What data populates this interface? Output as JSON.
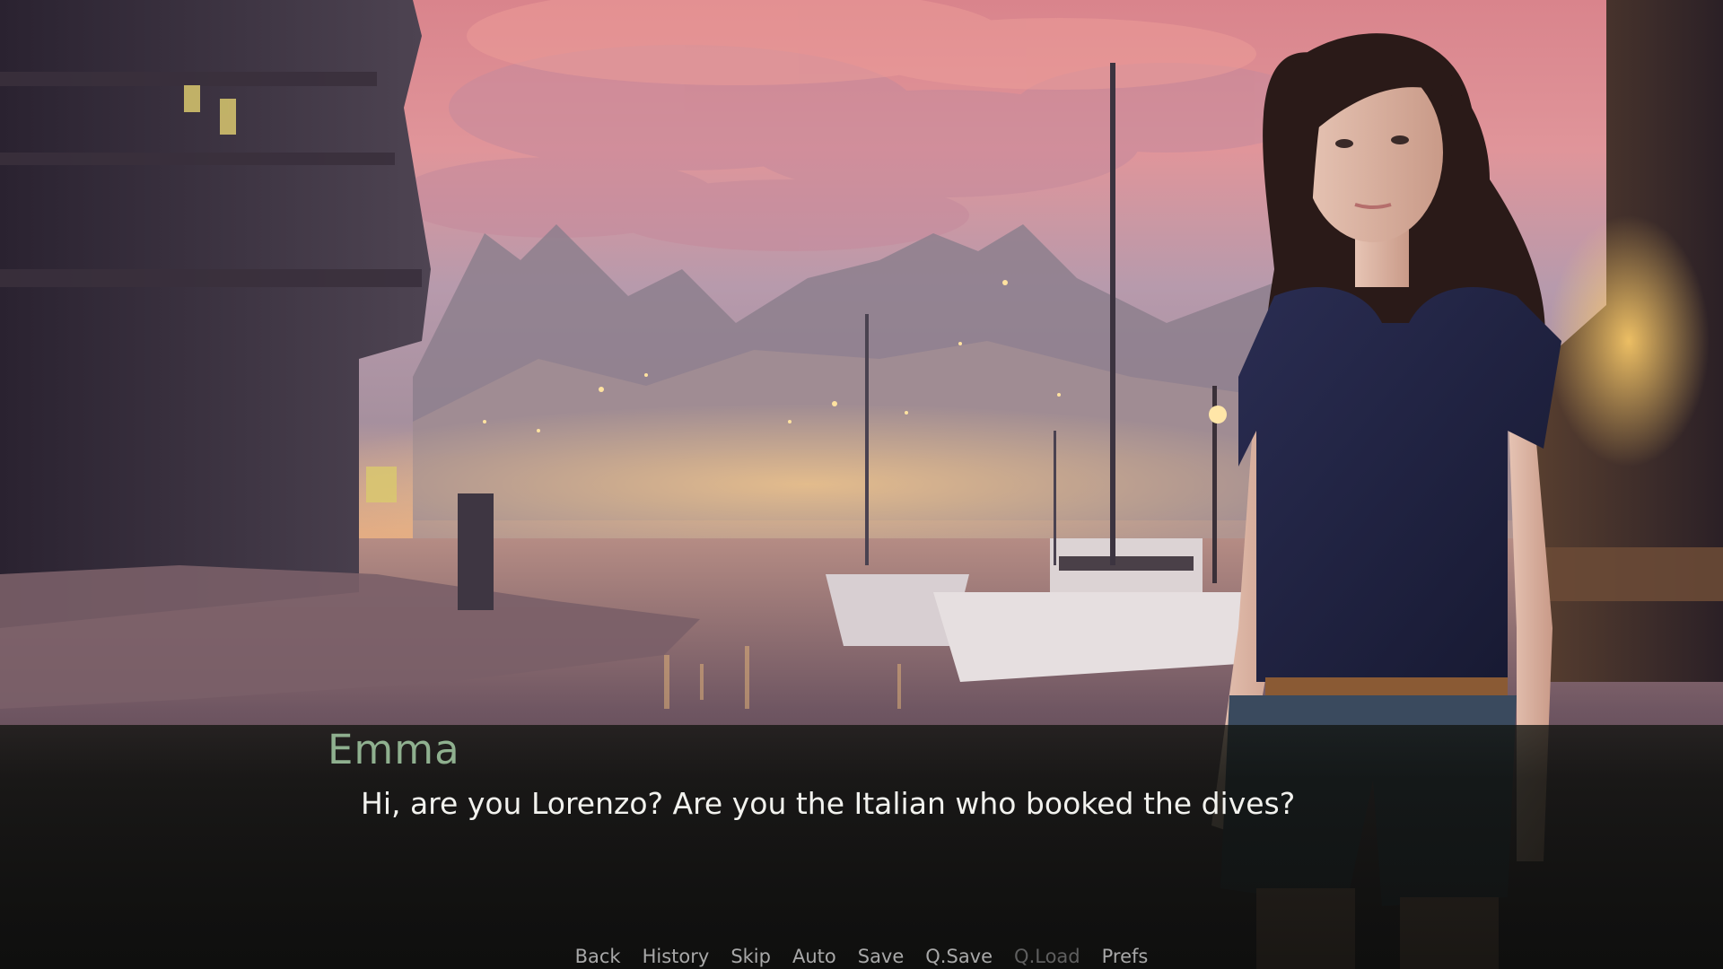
{
  "scene": {
    "background": "harbor-at-dusk",
    "character": "emma-sprite",
    "colors": {
      "sky_top": "#e38e92",
      "sky_mid": "#c49aa6",
      "haze": "#f2b277",
      "water": "#6b5560",
      "shirt": "#1d1f3a",
      "hair": "#2a1a18"
    }
  },
  "dialogue": {
    "speaker": "Emma",
    "speaker_color": "#8fb08f",
    "text": "Hi, are you Lorenzo? Are you the Italian who booked the dives?"
  },
  "quick_menu": [
    {
      "label": "Back",
      "enabled": true
    },
    {
      "label": "History",
      "enabled": true
    },
    {
      "label": "Skip",
      "enabled": true
    },
    {
      "label": "Auto",
      "enabled": true
    },
    {
      "label": "Save",
      "enabled": true
    },
    {
      "label": "Q.Save",
      "enabled": true
    },
    {
      "label": "Q.Load",
      "enabled": false
    },
    {
      "label": "Prefs",
      "enabled": true
    }
  ]
}
